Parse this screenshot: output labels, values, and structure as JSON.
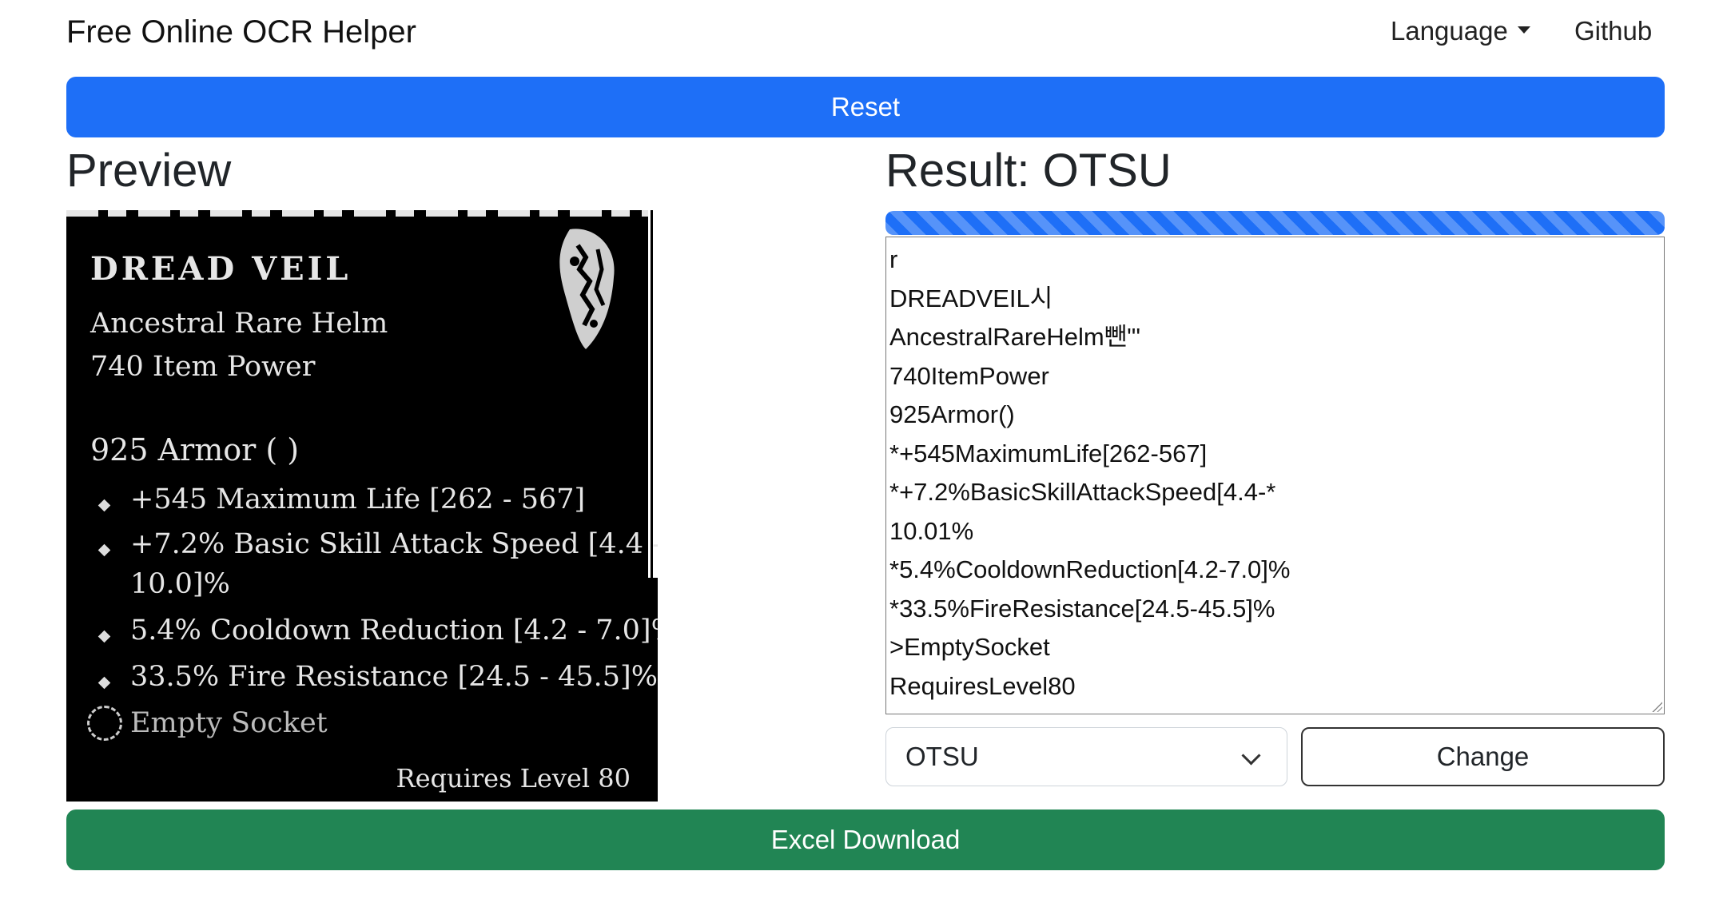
{
  "navbar": {
    "brand": "Free Online OCR Helper",
    "language_label": "Language",
    "github_label": "Github"
  },
  "reset_label": "Reset",
  "preview": {
    "heading": "Preview",
    "image": {
      "title": "DREAD VEIL",
      "subtitle": "Ancestral Rare Helm",
      "item_power": "740 Item Power",
      "armor": "925 Armor (      )",
      "attributes": [
        "+545 Maximum Life [262 - 567]",
        "+7.2% Basic Skill Attack Speed  [4.4 -",
        "10.0]%",
        "5.4% Cooldown Reduction [4.2 - 7.0]%",
        "33.5% Fire Resistance [24.5 - 45.5]%"
      ],
      "socket": "Empty Socket",
      "requirement": "Requires Level 80"
    }
  },
  "result": {
    "heading": "Result: OTSU",
    "progress_percent": 100,
    "text": "r\nDREADVEIL시\nAncestralRareHelm뺀\"'\n740ItemPower\n925Armor()\n*+545MaximumLife[262-567]\n*+7.2%BasicSkillAttackSpeed[4.4-*\n10.01%\n*5.4%CooldownReduction[4.2-7.0]%\n*33.5%FireResistance[24.5-45.5]%\n>EmptySocket\nRequiresLevel80"
  },
  "method_select": {
    "selected": "OTSU"
  },
  "change_label": "Change",
  "excel_label": "Excel Download",
  "colors": {
    "primary": "#1e6ff7",
    "success": "#218554"
  }
}
